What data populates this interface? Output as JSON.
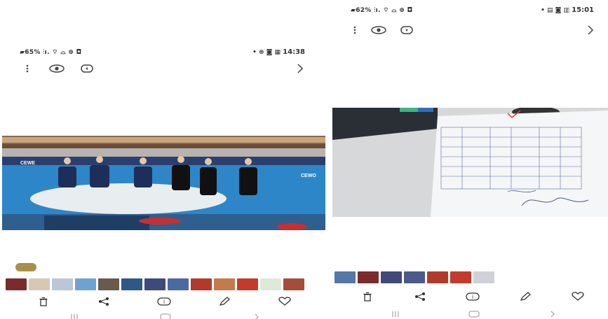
{
  "left": {
    "status": {
      "left_text": "▰65% ⫶ı. ⌔ ⌓ ⊕ ◘",
      "right_text": "• ⊛ ◙ ▦ ",
      "time": "14:38"
    },
    "topbar": {
      "more_icon": "more-vertical-icon",
      "eye_icon": "eye-icon",
      "remaster_icon": "remaster-icon",
      "next_icon": "chevron-right-icon"
    },
    "photo": {
      "banner_text_left": "CEWE",
      "banner_text_right": "CEWO"
    },
    "badge_icon": "remaster-badge-icon",
    "actions": [
      "trash-icon",
      "share-icon",
      "info-icon",
      "edit-icon",
      "heart-icon"
    ],
    "thumb_colors": [
      "#7a2b2b",
      "#d9c6b4",
      "#b9c7d8",
      "#6fa2d2",
      "#6a5a4c",
      "#2c5a86",
      "#3d4a7a",
      "#4a6aa2",
      "#b23a2a",
      "#c47a4a",
      "#c23b2b",
      "#dcead8",
      "#a64c3a"
    ]
  },
  "right": {
    "status": {
      "left_text": "▰62% ⫶ı. ⌔ ⌓ ⊕ ◘",
      "right_text": "• ▤ ◙ ▥ ",
      "time": "15:01"
    },
    "topbar": {
      "more_icon": "more-vertical-icon",
      "eye_icon": "eye-icon",
      "remaster_icon": "remaster-icon",
      "next_icon": "chevron-right-icon"
    },
    "actions": [
      "trash-icon",
      "share-icon",
      "info-icon",
      "edit-icon",
      "heart-icon"
    ],
    "thumb_colors": [
      "#5577aa",
      "#7a2b2b",
      "#3d4a7a",
      "#4a5a8a",
      "#b23a2a",
      "#c23b2b",
      "#d0d0d8"
    ]
  }
}
